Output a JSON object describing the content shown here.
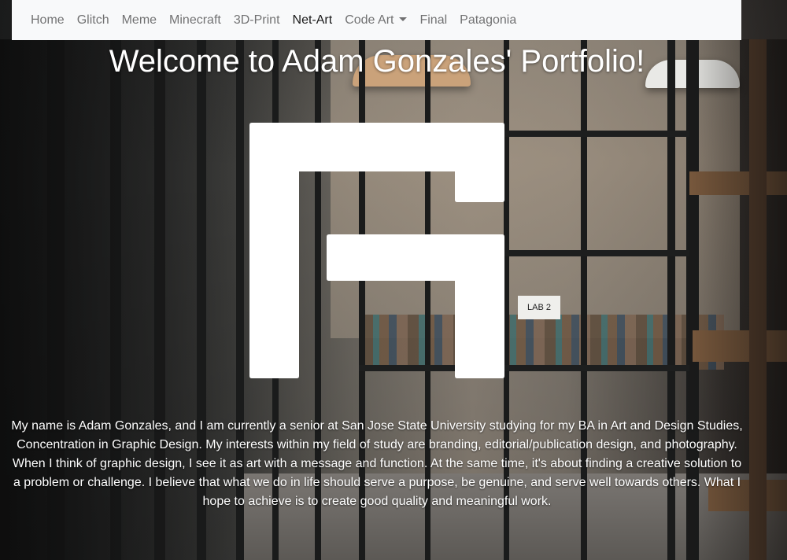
{
  "nav": {
    "items": [
      {
        "label": "Home",
        "active": false
      },
      {
        "label": "Glitch",
        "active": false
      },
      {
        "label": "Meme",
        "active": false
      },
      {
        "label": "Minecraft",
        "active": false
      },
      {
        "label": "3D-Print",
        "active": false
      },
      {
        "label": "Net-Art",
        "active": true
      },
      {
        "label": "Code Art",
        "active": false,
        "dropdown": true
      },
      {
        "label": "Final",
        "active": false
      },
      {
        "label": "Patagonia",
        "active": false
      }
    ]
  },
  "hero": {
    "title": "Welcome to Adam Gonzales' Portfolio!",
    "logo_icon": "ag-monogram-logo",
    "background_icon": "library-photo-background",
    "sign_text": "LAB 2",
    "intro": "My name is Adam Gonzales, and I am currently a senior at San Jose State University studying for my BA in Art and Design Studies, Concentration in Graphic Design. My interests within my field of study are branding, editorial/publication design, and photography. When I think of graphic design, I see it as art with a message and function. At the same time, it's about finding a creative solution to a problem or challenge. I believe that what we do in life should serve a purpose, be genuine, and serve well towards others. What I hope to achieve is to create good quality and meaningful work."
  },
  "colors": {
    "navbar_bg": "#f8f9fa",
    "nav_text": "#8c8c8c",
    "nav_active": "#1a1a1a",
    "hero_text": "#ffffff"
  }
}
